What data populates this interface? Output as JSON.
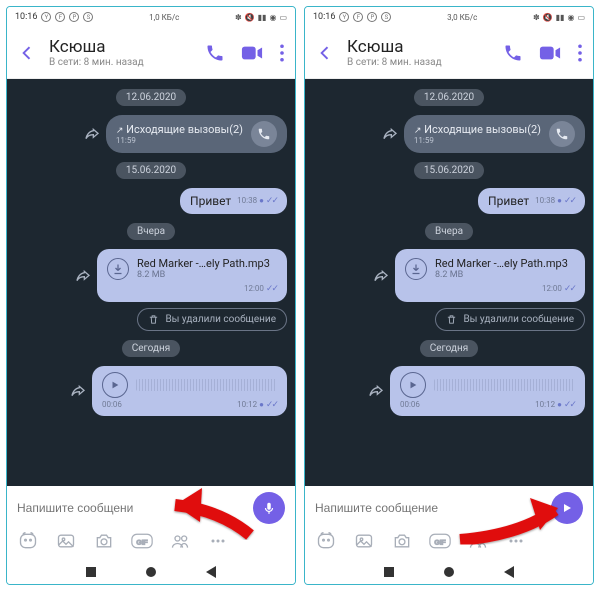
{
  "panes": [
    {
      "status": {
        "time": "10:16",
        "net_speed": "1,0 КБ/с"
      },
      "header": {
        "name": "Ксюша",
        "subtitle": "В сети: 8 мин. назад"
      },
      "chat": {
        "date1": "12.06.2020",
        "call_label": "Исходящие вызовы(2)",
        "call_time": "11:59",
        "date2": "15.06.2020",
        "msg_text": "Привет",
        "msg_time": "10:38",
        "date3": "Вчера",
        "file_name": "Red Marker -…ely Path.mp3",
        "file_size": "8.2 MB",
        "file_time": "12:00",
        "deleted_text": "Вы удалили сообщение",
        "date4": "Сегодня",
        "voice_dur": "00:06",
        "voice_time": "10:12"
      },
      "composer": {
        "placeholder": "Напишите сообщени"
      }
    },
    {
      "status": {
        "time": "10:16",
        "net_speed": "3,0 КБ/с"
      },
      "header": {
        "name": "Ксюша",
        "subtitle": "В сети: 8 мин. назад"
      },
      "chat": {
        "date1": "12.06.2020",
        "call_label": "Исходящие вызовы(2)",
        "call_time": "11:59",
        "date2": "15.06.2020",
        "msg_text": "Привет",
        "msg_time": "10:38",
        "date3": "Вчера",
        "file_name": "Red Marker -…ely Path.mp3",
        "file_size": "8.2 MB",
        "file_time": "12:00",
        "deleted_text": "Вы удалили сообщение",
        "date4": "Сегодня",
        "voice_dur": "00:06",
        "voice_time": "10:12"
      },
      "composer": {
        "placeholder": "Напишите сообщение"
      }
    }
  ]
}
